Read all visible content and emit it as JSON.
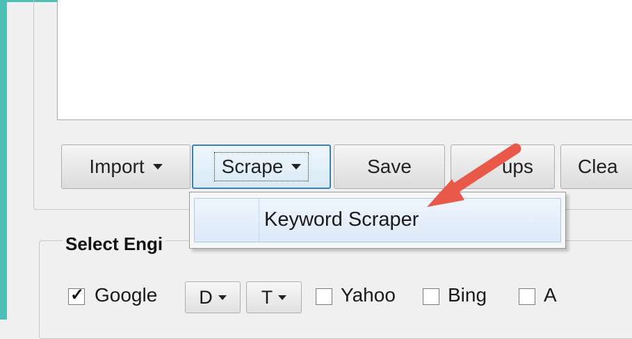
{
  "toolbar": {
    "import_label": "Import",
    "scrape_label": "Scrape",
    "save_label": "Save",
    "dups_label": "ups",
    "clear_label": "Clea"
  },
  "scrape_menu": {
    "items": [
      {
        "label": "Keyword Scraper"
      }
    ]
  },
  "engines_group": {
    "title": "Select Engi",
    "engines": [
      {
        "label": "Google",
        "checked": true
      },
      {
        "label": "Yahoo",
        "checked": false
      },
      {
        "label": "Bing",
        "checked": false
      },
      {
        "label": "A",
        "checked": false
      }
    ],
    "google_dropdown_d": "D",
    "google_dropdown_t": "T"
  },
  "colors": {
    "accent": "#4fbfb6",
    "arrow": "#e8594a",
    "focus_border": "#3c7fb1"
  },
  "icons": {
    "checkbox_checked": "check-icon",
    "dropdown": "caret-down-icon"
  }
}
